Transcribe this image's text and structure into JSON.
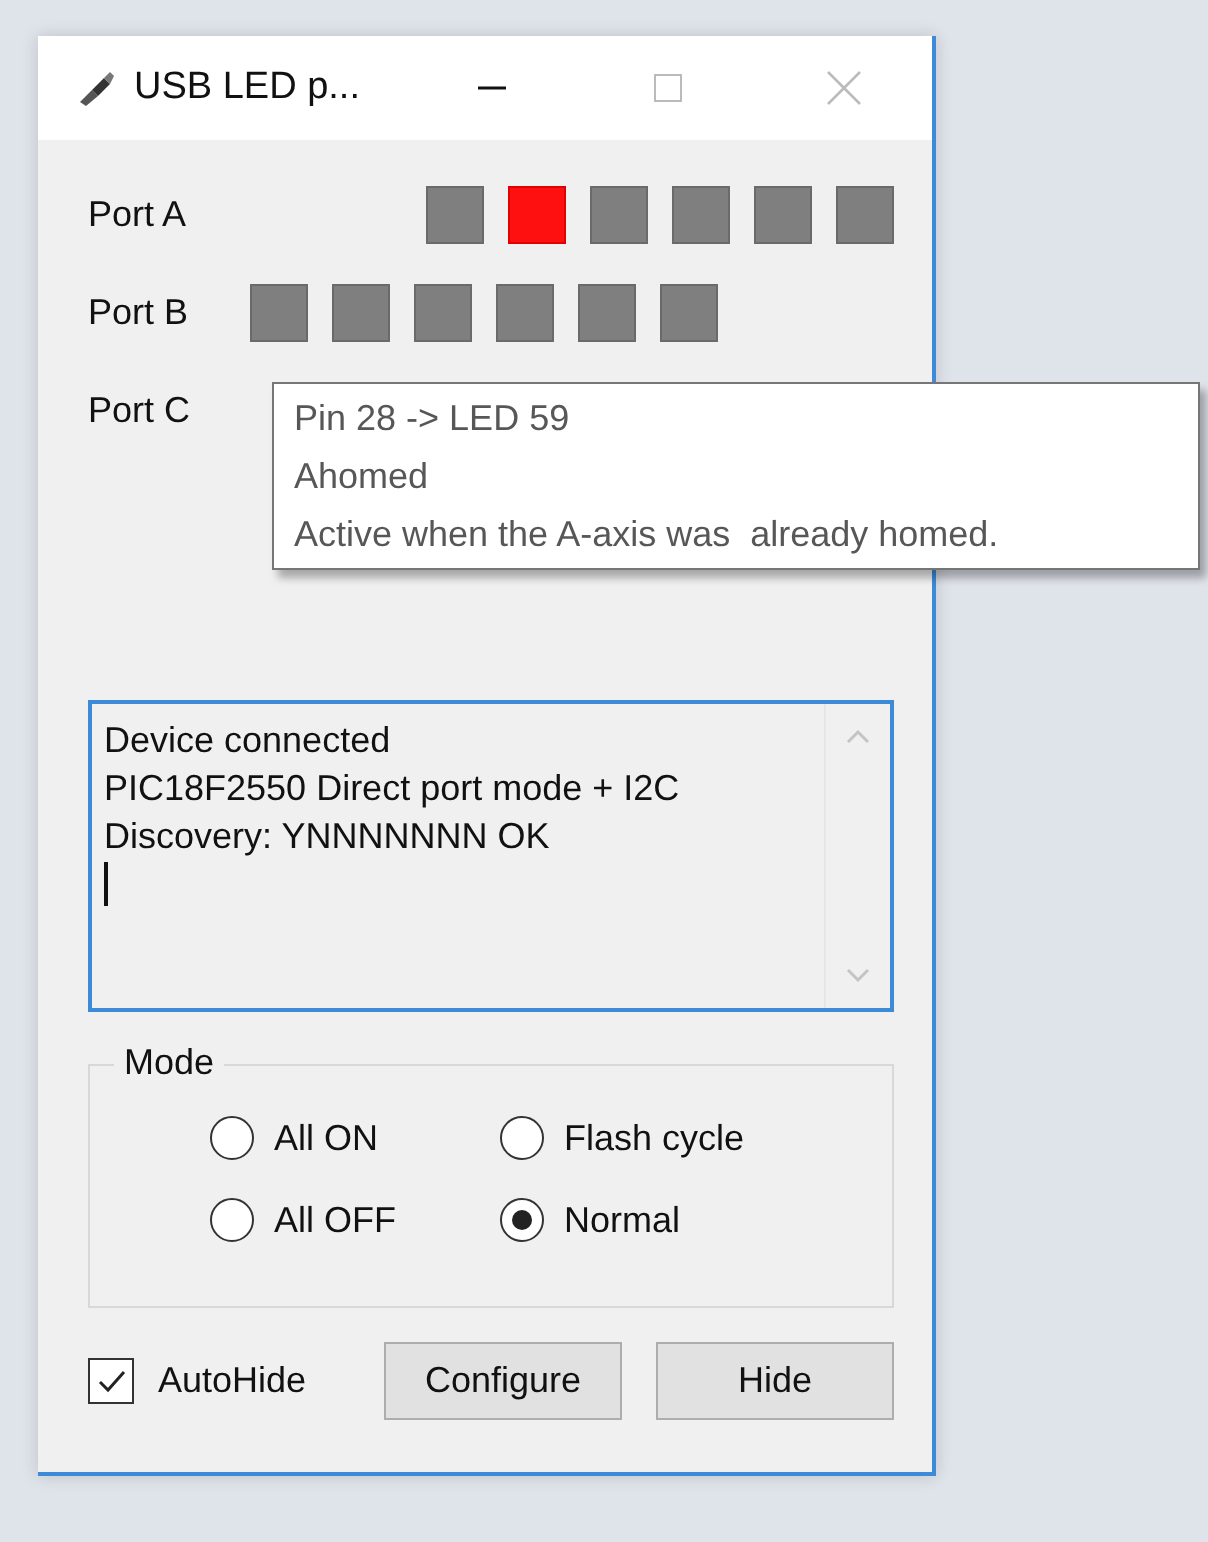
{
  "window": {
    "title": "USB LED p..."
  },
  "ports": [
    {
      "label": "Port A",
      "kind": "shifted",
      "leds": [
        {
          "on": false
        },
        {
          "on": true
        },
        {
          "on": false
        },
        {
          "on": false
        },
        {
          "on": false
        },
        {
          "on": false
        }
      ]
    },
    {
      "label": "Port B",
      "kind": "plain",
      "leds": [
        {
          "on": false
        },
        {
          "on": false
        },
        {
          "on": false
        },
        {
          "on": false
        },
        {
          "on": false
        },
        {
          "on": false
        }
      ]
    },
    {
      "label": "Port C"
    }
  ],
  "tooltip": {
    "lines": [
      "Pin 28 -> LED 59",
      "Ahomed",
      "Active when the A-axis was  already homed."
    ]
  },
  "log": {
    "lines": [
      "Device connected",
      "PIC18F2550 Direct port mode + I2C",
      "Discovery: YNNNNNNN OK"
    ]
  },
  "mode": {
    "title": "Mode",
    "options": [
      {
        "label": "All ON",
        "selected": false
      },
      {
        "label": "Flash cycle",
        "selected": false
      },
      {
        "label": "All OFF",
        "selected": false
      },
      {
        "label": "Normal",
        "selected": true
      }
    ]
  },
  "autohide": {
    "label": "AutoHide",
    "checked": true
  },
  "buttons": [
    "Configure",
    "Hide"
  ]
}
